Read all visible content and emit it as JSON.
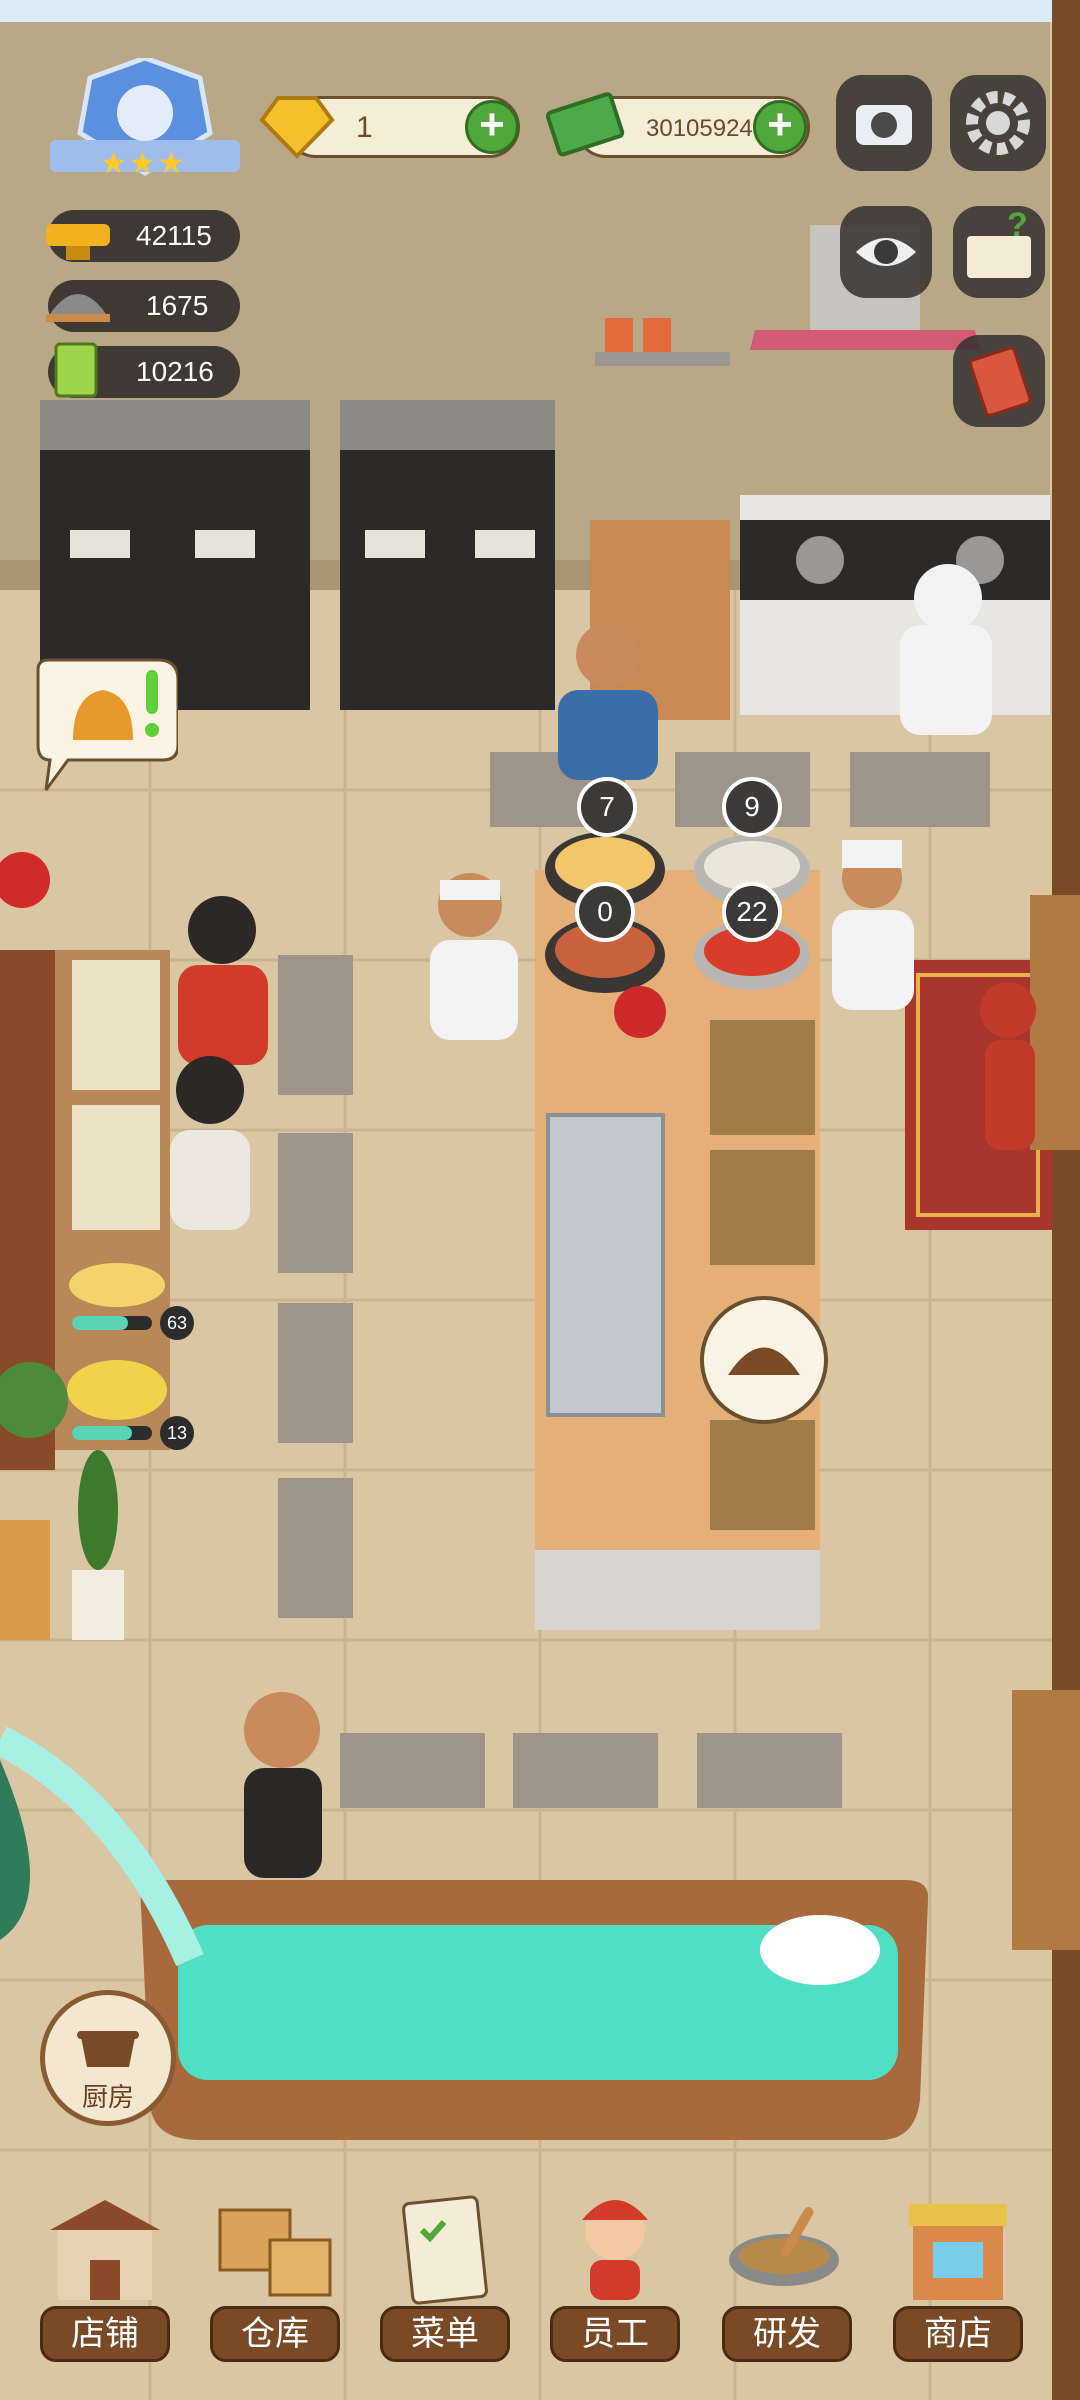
{
  "colors": {
    "floor": "#d9c7a3",
    "floor_tile_line": "#c9b48e",
    "wall": "#b9a886",
    "plus_green": "#4fa83a",
    "water": "#4fe0c4",
    "nav_label_bg": "#7a4a26"
  },
  "top_bar": {
    "gems": {
      "value": "1",
      "icon": "gem-icon"
    },
    "cash": {
      "value": "30105924",
      "icon": "cash-icon"
    },
    "level_badge": {
      "icon": "chef-badge-icon",
      "stars": 3
    },
    "camera_icon": "camera-icon",
    "settings_icon": "gear-icon"
  },
  "stats": [
    {
      "icon": "hotpot-icon",
      "value": "42115"
    },
    {
      "icon": "cloche-icon",
      "value": "1675"
    },
    {
      "icon": "recipe-book-icon",
      "value": "10216"
    }
  ],
  "side_buttons": {
    "view_icon": "eye-icon",
    "guide_icon": "question-book-icon",
    "menu_book_icon": "red-book-icon"
  },
  "timers": {
    "pot_a": "7",
    "pot_b": "9",
    "pot_c": "0",
    "pot_d": "22"
  },
  "prep_progress": [
    {
      "value": "63",
      "fill": 0.7
    },
    {
      "value": "13",
      "fill": 0.75
    }
  ],
  "kitchen_button": {
    "label": "厨房",
    "icon": "kitchen-pot-icon"
  },
  "bottom_nav": [
    {
      "label": "店铺",
      "icon": "shop-building-icon"
    },
    {
      "label": "仓库",
      "icon": "warehouse-boxes-icon"
    },
    {
      "label": "菜单",
      "icon": "menu-clipboard-icon"
    },
    {
      "label": "员工",
      "icon": "staff-icon"
    },
    {
      "label": "研发",
      "icon": "wok-research-icon"
    },
    {
      "label": "商店",
      "icon": "store-icon"
    }
  ]
}
